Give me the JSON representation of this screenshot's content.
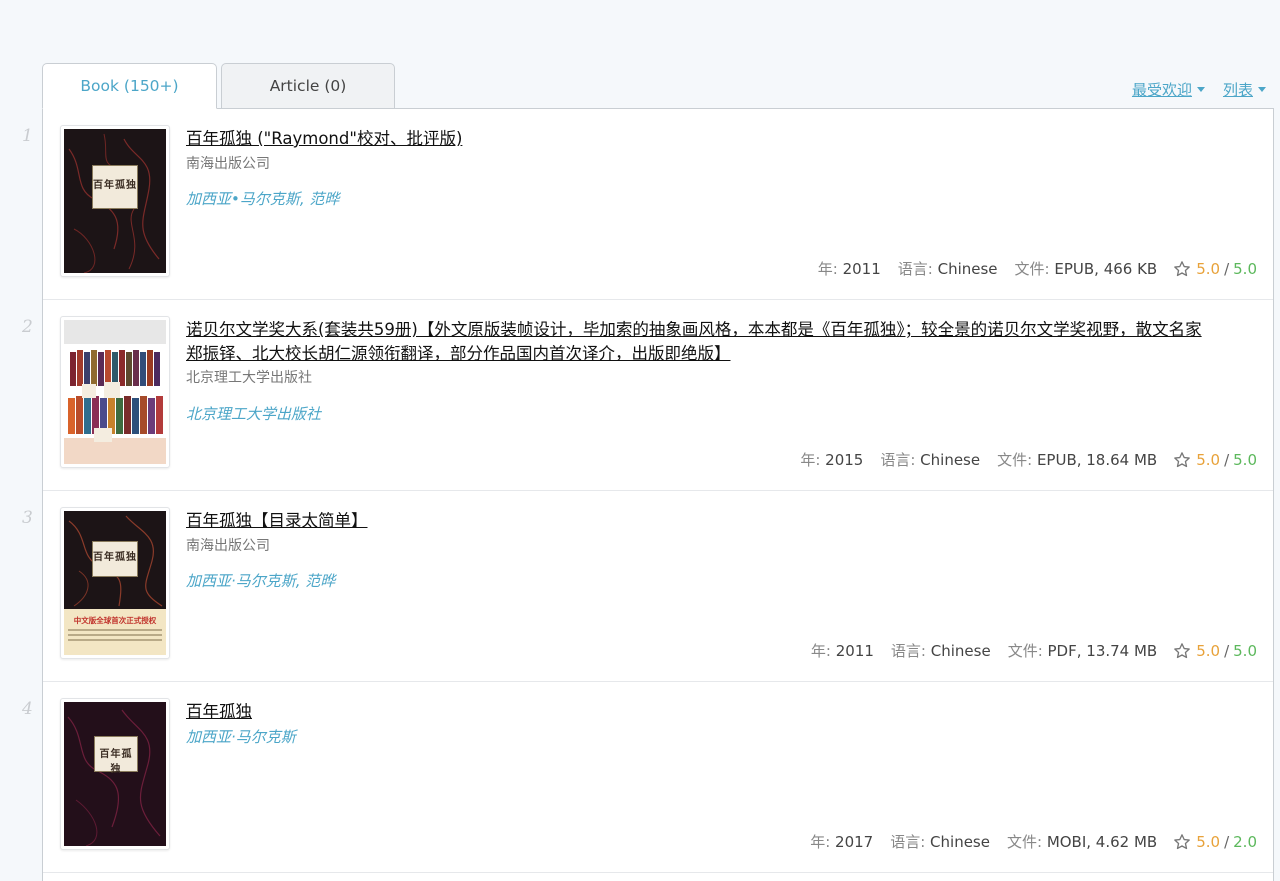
{
  "tabs": [
    {
      "label": "Book (150+)",
      "active": true
    },
    {
      "label": "Article (0)",
      "active": false
    }
  ],
  "sort": {
    "popular": "最受欢迎",
    "view": "列表"
  },
  "labels": {
    "year": "年: ",
    "language": "语言: ",
    "file": "文件: ",
    "rating_sep": "/"
  },
  "colors": {
    "accent": "#4ca6c8",
    "rating_primary": "#e8a23a",
    "rating_secondary": "#5cb85c"
  },
  "items": [
    {
      "num": "1",
      "title": "百年孤独 (\"Raymond\"校对、批评版)",
      "publisher": "南海出版公司",
      "authors": "加西亚•马尔克斯, 范晔",
      "year": "2011",
      "language": "Chinese",
      "file": "EPUB, 466 KB",
      "rating1": "5.0",
      "rating2": "5.0",
      "cover": {
        "text": "百年孤独"
      }
    },
    {
      "num": "2",
      "title": "诺贝尔文学奖大系(套装共59册)【外文原版装帧设计，毕加索的抽象画风格，本本都是《百年孤独》；较全景的诺贝尔文学奖视野，散文名家郑振铎、北大校长胡仁源领衔翻译，部分作品国内首次译介，出版即绝版】",
      "publisher": "北京理工大学出版社",
      "authors": "北京理工大学出版社",
      "year": "2015",
      "language": "Chinese",
      "file": "EPUB, 18.64 MB",
      "rating1": "5.0",
      "rating2": "5.0"
    },
    {
      "num": "3",
      "title": "百年孤独【目录太简单】",
      "publisher": "南海出版公司",
      "authors": "加西亚·马尔克斯, 范晔",
      "year": "2011",
      "language": "Chinese",
      "file": "PDF, 13.74 MB",
      "rating1": "5.0",
      "rating2": "5.0",
      "cover": {
        "text": "百年孤独",
        "band": "中文版全球首次正式授权"
      }
    },
    {
      "num": "4",
      "title": "百年孤独",
      "authors": "加西亚·马尔克斯",
      "year": "2017",
      "language": "Chinese",
      "file": "MOBI, 4.62 MB",
      "rating1": "5.0",
      "rating2": "2.0",
      "cover": {
        "text": "百年孤独"
      }
    }
  ]
}
